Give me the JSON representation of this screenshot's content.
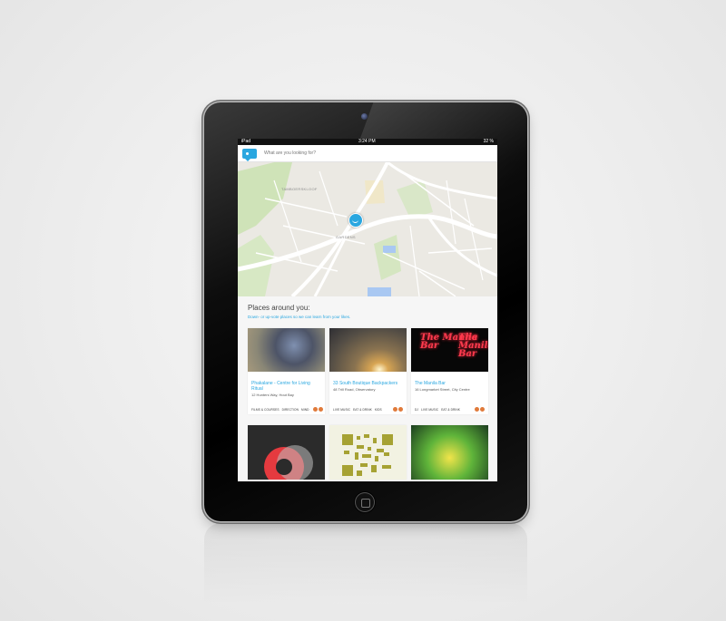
{
  "status_bar": {
    "device": "iPad",
    "time": "3:24 PM",
    "battery": "32 %"
  },
  "app": {
    "search": {
      "placeholder": "What are you looking for?"
    }
  },
  "map": {
    "labels": [
      "TAMBOERSKLOOF",
      "GARDENS"
    ]
  },
  "places": {
    "title": "Places around you:",
    "subtitle": "Down- or up-vote places so we can learn from your likes.",
    "cards": [
      {
        "title": "Phakalane - Centre for Living Ritual",
        "address": "12 Hunters Way, Hout Bay",
        "tags": [
          "FILMS & COURSES",
          "DIRECTION",
          "MIND"
        ]
      },
      {
        "title": "33 South Boutique Backpackers",
        "address": "48 Trill Road, Observatory",
        "tags": [
          "LIVE MUSIC",
          "EAT & DRINK",
          "KIDS"
        ]
      },
      {
        "title": "The Manila Bar",
        "address": "16 Longmarket Street, City Centre",
        "tags": [
          "DJ",
          "LIVE MUSIC",
          "EAT & DRINK"
        ],
        "image_text": "The Manila Bar"
      }
    ]
  },
  "colors": {
    "accent": "#2aa7e0",
    "vote": "#e07a3a"
  }
}
